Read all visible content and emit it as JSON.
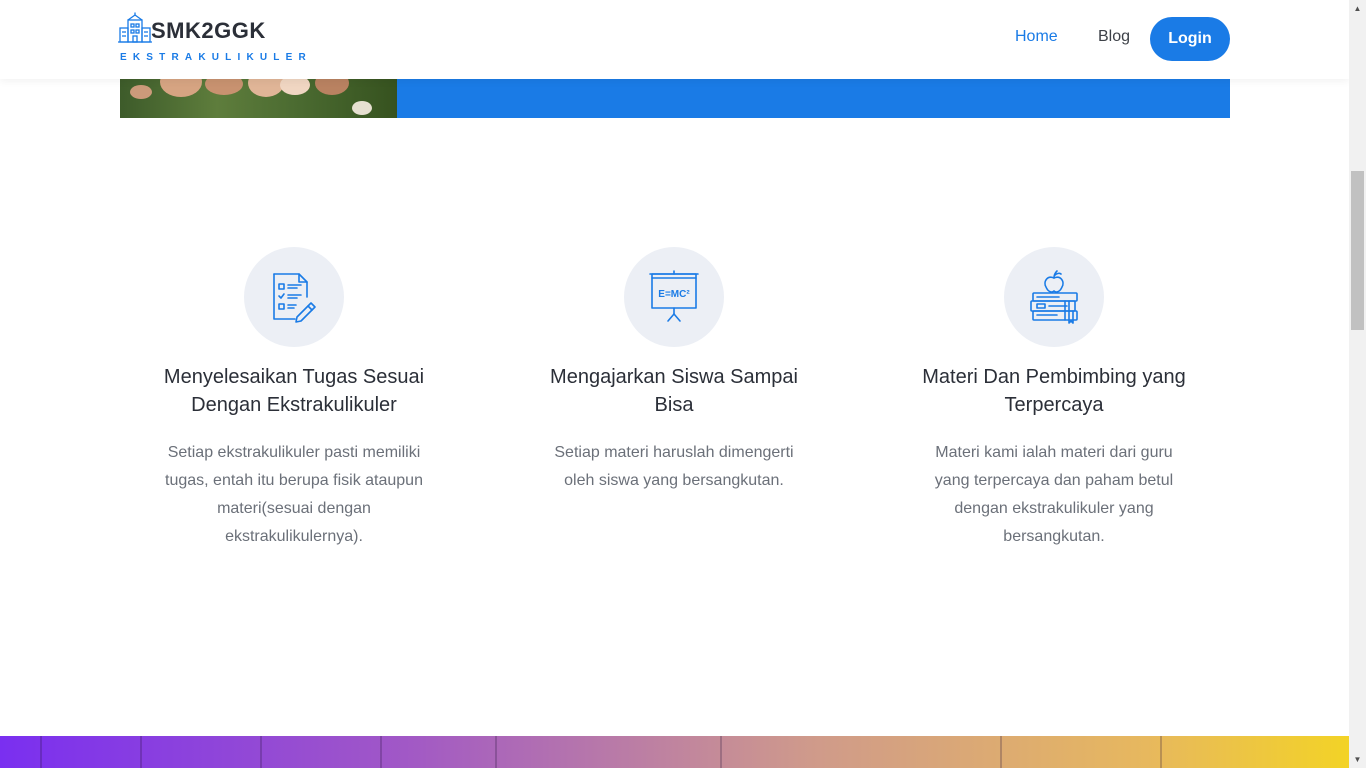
{
  "header": {
    "brand_name": "SMK2GGK",
    "brand_tagline": "EKSTRAKULIKULER",
    "brand_icon": "school-building-icon",
    "nav": {
      "home": "Home",
      "blog": "Blog",
      "login": "Login"
    }
  },
  "hero": {
    "photo": "hands-together-photo",
    "accent_color": "#1a7be6"
  },
  "features": [
    {
      "icon": "checklist-document-icon",
      "title": "Menyelesaikan Tugas Sesuai Dengan Ekstrakulikuler",
      "text": "Setiap ekstrakulikuler pasti memiliki tugas, entah itu berupa fisik ataupun materi(sesuai dengan ekstrakulikulernya)."
    },
    {
      "icon": "presentation-board-icon",
      "icon_text": "E=MC²",
      "title": "Mengajarkan Siswa Sampai Bisa",
      "text": "Setiap materi haruslah dimengerti oleh siswa yang bersangkutan."
    },
    {
      "icon": "books-apple-icon",
      "title": "Materi Dan Pembimbing yang Terpercaya",
      "text": "Materi kami ialah materi dari guru yang terpercaya dan paham betul dengan ekstrakulikuler yang bersangkutan."
    }
  ],
  "colors": {
    "primary": "#1a7be6",
    "heading": "#2b2f38",
    "body_text": "#6b7079",
    "icon_bg": "#eceff5"
  }
}
